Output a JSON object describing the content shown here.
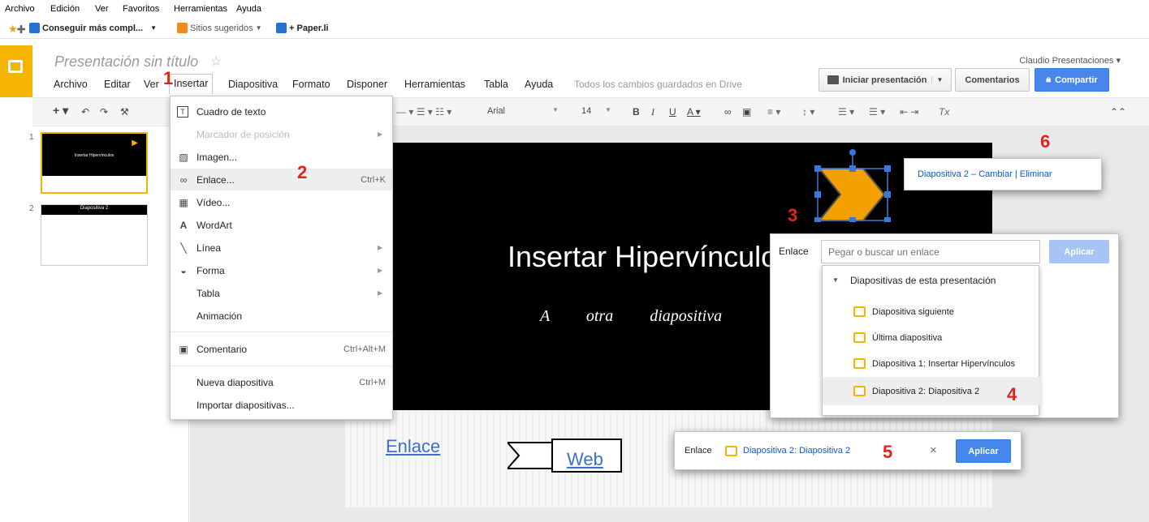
{
  "browser": {
    "menu": [
      "Archivo",
      "Edición",
      "Ver",
      "Favoritos",
      "Herramientas",
      "Ayuda"
    ],
    "favorites": [
      {
        "label": "Conseguir más compl...",
        "icon": "ie-icon"
      },
      {
        "label": "Sitios sugeridos",
        "icon": "suggested-sites-icon"
      },
      {
        "label": "+ Paper.li",
        "icon": "ie-icon"
      }
    ]
  },
  "app": {
    "title": "Presentación sin título",
    "user": "Claudio Presentaciones",
    "saved_status": "Todos los cambios guardados en Drive",
    "menu": [
      "Archivo",
      "Editar",
      "Ver",
      "Insertar",
      "Diapositiva",
      "Formato",
      "Disponer",
      "Herramientas",
      "Tabla",
      "Ayuda"
    ],
    "buttons": {
      "present": "Iniciar presentación",
      "comments": "Comentarios",
      "share": "Compartir"
    },
    "accent": "#f4b400",
    "share_color": "#4787ed"
  },
  "toolbar": {
    "font": "Arial",
    "size": "14"
  },
  "filmstrip": {
    "slides": [
      {
        "num": "1",
        "title": "Insertar Hipervínculos"
      },
      {
        "num": "2",
        "title": "Diapositiva 2"
      }
    ]
  },
  "insert_menu": {
    "items": [
      {
        "label": "Cuadro de texto",
        "icon": "textbox-icon",
        "shortcut": ""
      },
      {
        "label": "Marcador de posición",
        "icon": "",
        "shortcut": "",
        "disabled": true,
        "submenu": true
      },
      {
        "label": "Imagen...",
        "icon": "image-icon",
        "shortcut": ""
      },
      {
        "label": "Enlace...",
        "icon": "link-icon",
        "shortcut": "Ctrl+K"
      },
      {
        "label": "Vídeo...",
        "icon": "video-icon",
        "shortcut": ""
      },
      {
        "label": "WordArt",
        "icon": "wordart-icon",
        "shortcut": ""
      },
      {
        "label": "Línea",
        "icon": "line-icon",
        "shortcut": "",
        "submenu": true
      },
      {
        "label": "Forma",
        "icon": "shape-icon",
        "shortcut": "",
        "submenu": true
      },
      {
        "label": "Tabla",
        "icon": "",
        "shortcut": "",
        "submenu": true
      },
      {
        "label": "Animación",
        "icon": "",
        "shortcut": ""
      },
      {
        "label": "Comentario",
        "icon": "comment-icon",
        "shortcut": "Ctrl+Alt+M"
      },
      {
        "label": "Nueva diapositiva",
        "icon": "",
        "shortcut": "Ctrl+M"
      },
      {
        "label": "Importar diapositivas...",
        "icon": "",
        "shortcut": ""
      }
    ]
  },
  "slide": {
    "title": "Insertar Hipervínculos",
    "subtitle": "A otra diapositiva",
    "link_text": "Enlace",
    "web_text": "Web"
  },
  "link_popup": {
    "label": "Enlace",
    "placeholder": "Pegar o buscar un enlace",
    "apply": "Aplicar",
    "group": "Diapositivas de esta presentación",
    "options": [
      "Diapositiva siguiente",
      "Última diapositiva",
      "Diapositiva 1: Insertar Hipervínculos",
      "Diapositiva 2: Diapositiva 2"
    ]
  },
  "link_bar": {
    "label": "Enlace",
    "value": "Diapositiva 2: Diapositiva 2",
    "close": "×",
    "apply": "Aplicar"
  },
  "link_tooltip": {
    "text": "Diapositiva 2 – Cambiar | Eliminar"
  },
  "step_numbers": [
    "1",
    "2",
    "3",
    "4",
    "5",
    "6"
  ]
}
